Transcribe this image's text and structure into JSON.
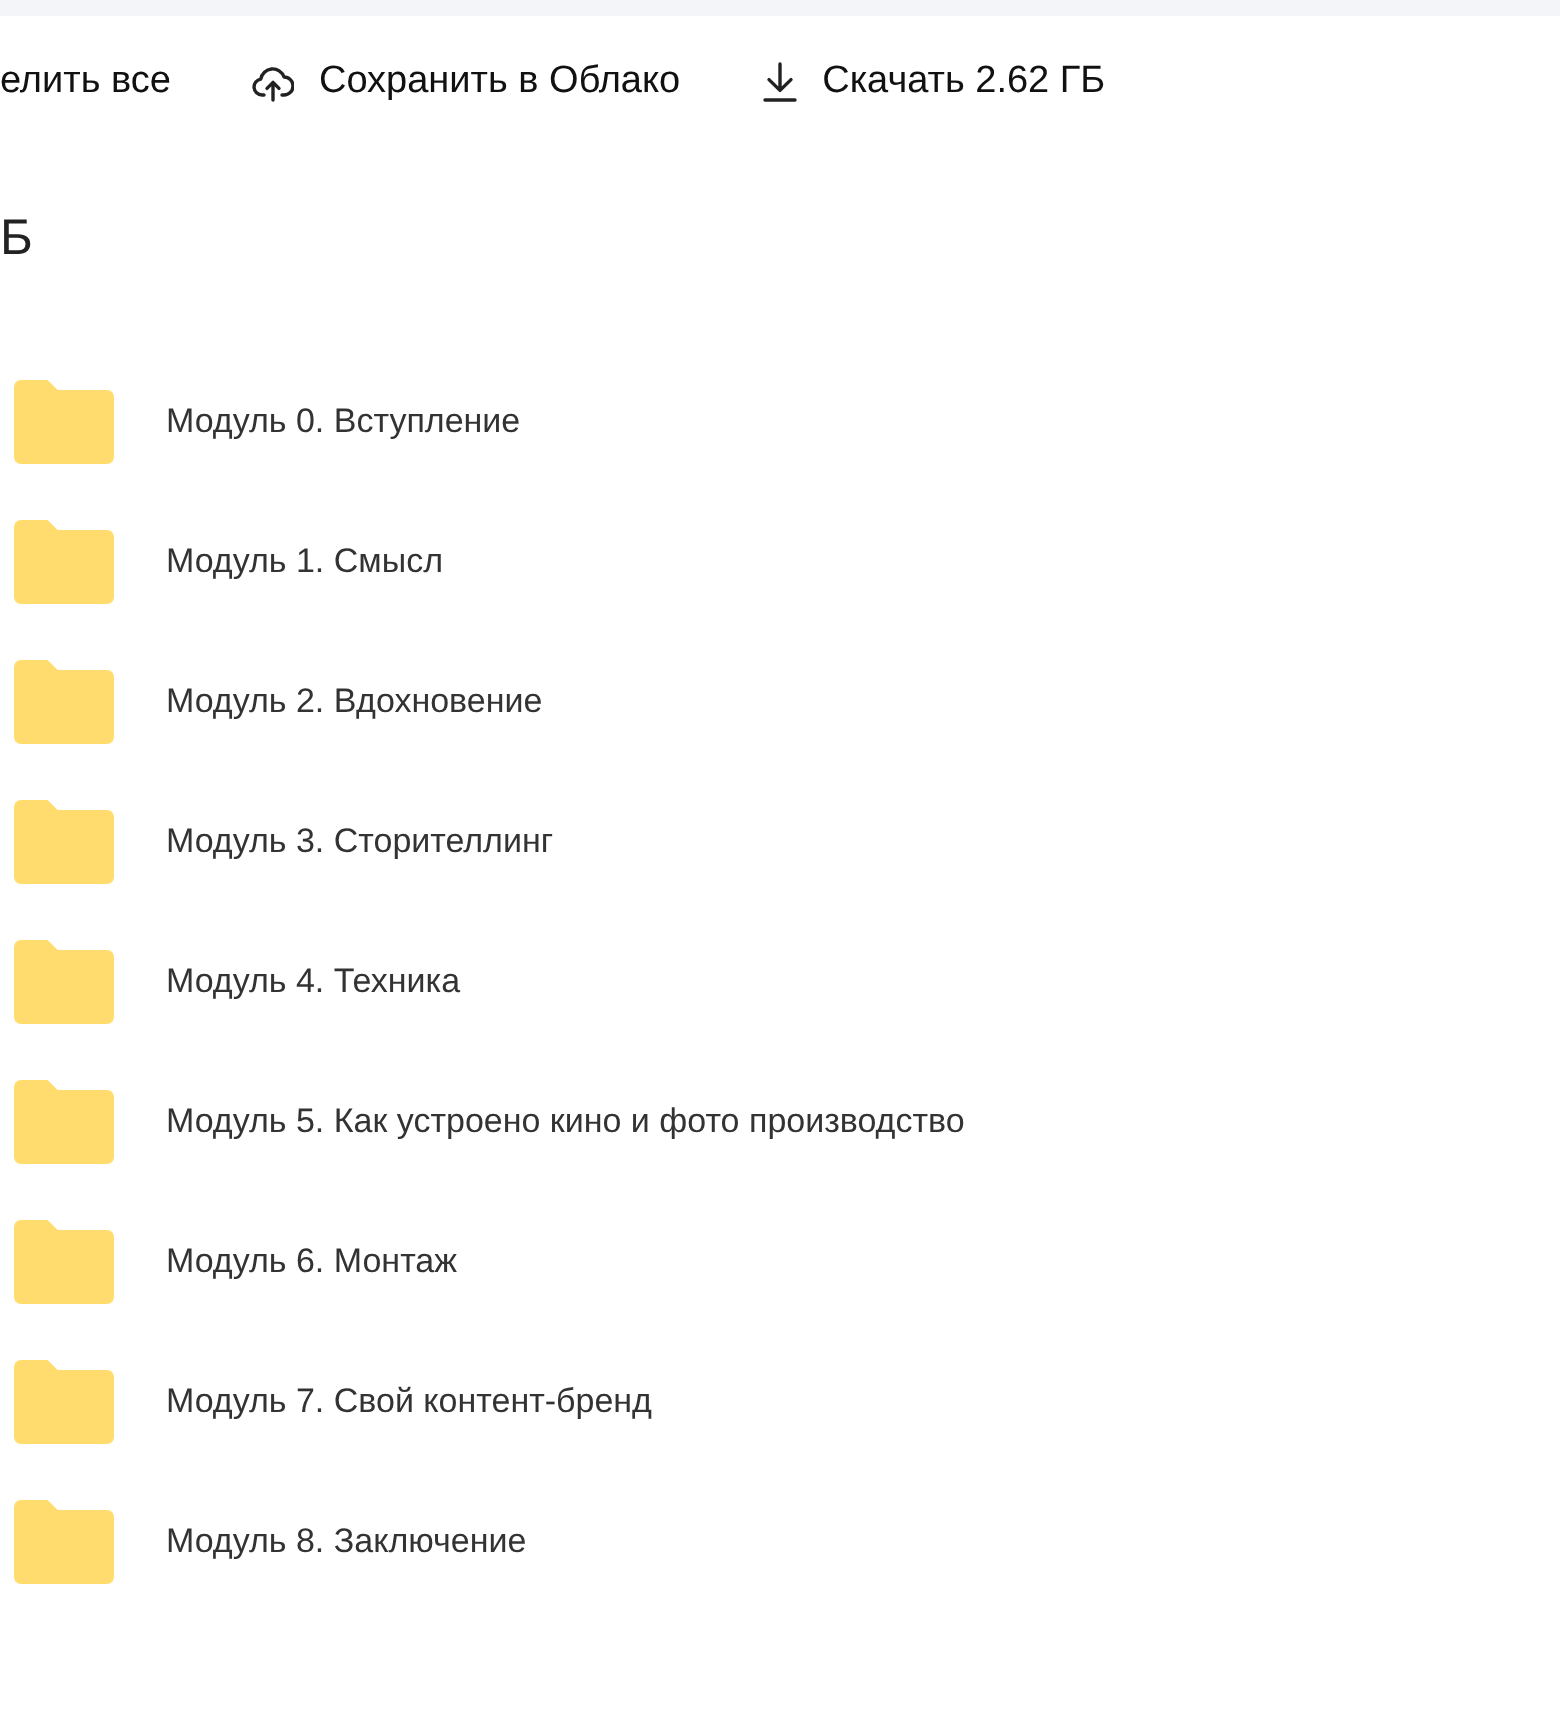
{
  "toolbar": [
    {
      "kind": "plain",
      "label": "елить все"
    },
    {
      "kind": "upload",
      "label": "Сохранить в Облако"
    },
    {
      "kind": "download",
      "label": "Скачать 2.62 ГБ"
    }
  ],
  "heading": "Б",
  "folders": [
    {
      "name": "Модуль 0. Вступление"
    },
    {
      "name": "Модуль 1. Смысл"
    },
    {
      "name": "Модуль 2. Вдохновение"
    },
    {
      "name": "Модуль 3. Сторителлинг"
    },
    {
      "name": "Модуль 4. Техника"
    },
    {
      "name": "Модуль 5. Как устроено кино и фото производство"
    },
    {
      "name": "Модуль 6. Монтаж"
    },
    {
      "name": "Модуль 7. Свой контент-бренд"
    },
    {
      "name": "Модуль 8. Заключение"
    }
  ]
}
